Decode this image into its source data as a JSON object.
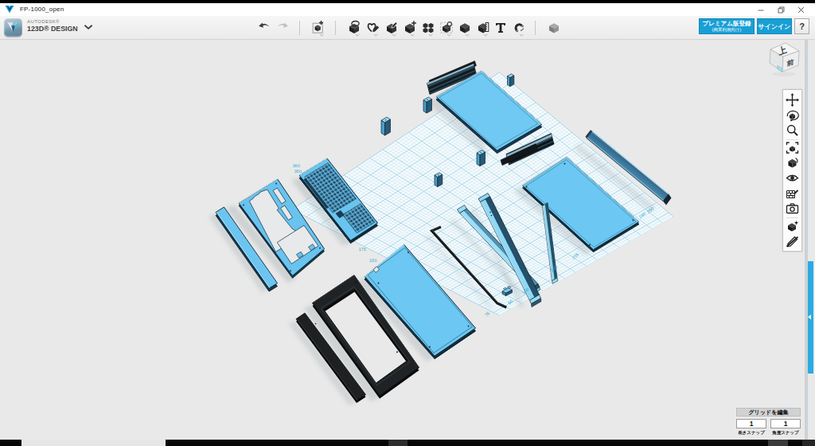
{
  "window": {
    "title": "FP-1000_open"
  },
  "toolbar": {
    "brand_line1": "AUTODESK®",
    "brand_line2": "123D® DESIGN",
    "tools": [
      "undo",
      "redo",
      "transform",
      "primitives",
      "sketch",
      "construct",
      "modify",
      "pattern",
      "grouping",
      "combine",
      "measure",
      "text",
      "snap",
      "material"
    ],
    "buttons": {
      "premium_label": "プレミアム版登録",
      "premium_sublabel": "(商業利用向け)",
      "signin_label": "サインイン",
      "help_label": "?"
    }
  },
  "viewcube": {
    "top_label": "上",
    "front_label": "前"
  },
  "right_toolbar": [
    "pan",
    "orbit",
    "zoom",
    "fit-view",
    "shading-mode",
    "visibility",
    "materials",
    "screenshot",
    "show-solids",
    "hide-sketches"
  ],
  "grid_panel": {
    "edit_button_label": "グリッドを編集",
    "length_snap_value": "1",
    "angle_snap_value": "1",
    "length_snap_label": "長さスナップ",
    "angle_snap_label": "角度スナップ"
  },
  "scene": {
    "grid_labels": [
      {
        "text": "360"
      },
      {
        "text": "350"
      },
      {
        "text": "175"
      },
      {
        "text": "150"
      },
      {
        "text": "75"
      },
      {
        "text": "50"
      },
      {
        "text": "100"
      },
      {
        "text": "200"
      },
      {
        "text": "225"
      },
      {
        "text": "240"
      },
      {
        "text": "250"
      }
    ],
    "parts": [
      "keyboard",
      "mounting-plate",
      "side-bar",
      "front-bezel-frame",
      "front-bar",
      "keyboard-tray-panel",
      "case-top-panel",
      "case-bottom-panel",
      "rear-strip",
      "vent-strip-top",
      "vent-strip-right",
      "support-rail-1",
      "support-rail-2",
      "support-rail-3",
      "trim-rod",
      "standoff-1",
      "standoff-2",
      "standoff-3",
      "standoff-4",
      "standoff-5",
      "connector-block"
    ]
  },
  "colors": {
    "accent_blue": "#189fd5",
    "model_blue": "#6cc7f2",
    "canvas_bg": "#e9e9e9",
    "panel_tab_blue": "#29abe2",
    "grid_line": "#bfe2ef"
  }
}
